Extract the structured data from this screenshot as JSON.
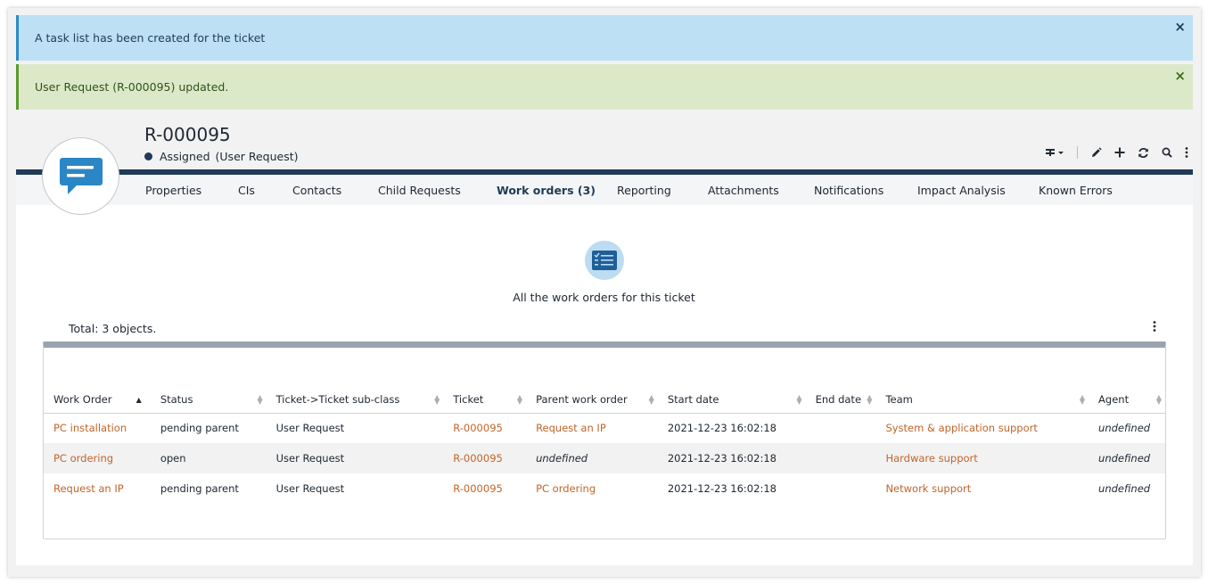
{
  "alerts": {
    "info": "A task list has been created for the ticket",
    "success": "User Request (R-000095) updated.",
    "close_symbol": "×"
  },
  "ticket": {
    "ref": "R-000095",
    "status": "Assigned",
    "class": "(User Request)"
  },
  "toolbar": {
    "icons": [
      "filter-dropdown-icon",
      "pencil-icon",
      "plus-icon",
      "refresh-icon",
      "search-icon",
      "more-vertical-icon"
    ]
  },
  "tabs": [
    {
      "label": "Properties"
    },
    {
      "label": "CIs"
    },
    {
      "label": "Contacts"
    },
    {
      "label": "Child Requests"
    },
    {
      "label": "Work orders (3)",
      "active": true
    },
    {
      "label": "Reporting"
    },
    {
      "label": "Attachments"
    },
    {
      "label": "Notifications"
    },
    {
      "label": "Impact Analysis"
    },
    {
      "label": "Known Errors"
    }
  ],
  "work_orders": {
    "description": "All the work orders for this ticket",
    "total": "Total: 3 objects.",
    "columns": [
      "Work Order",
      "Status",
      "Ticket->Ticket sub-class",
      "Ticket",
      "Parent work order",
      "Start date",
      "End date",
      "Team",
      "Agent"
    ],
    "rows": [
      {
        "work_order": "PC installation",
        "status": "pending parent",
        "subclass": "User Request",
        "ticket": "R-000095",
        "parent": "Request an IP",
        "start": "2021-12-23 16:02:18",
        "end": "",
        "team": "System & application support",
        "agent": "undefined"
      },
      {
        "work_order": "PC ordering",
        "status": "open",
        "subclass": "User Request",
        "ticket": "R-000095",
        "parent": "undefined",
        "start": "2021-12-23 16:02:18",
        "end": "",
        "team": "Hardware support",
        "agent": "undefined"
      },
      {
        "work_order": "Request an IP",
        "status": "pending parent",
        "subclass": "User Request",
        "ticket": "R-000095",
        "parent": "PC ordering",
        "start": "2021-12-23 16:02:18",
        "end": "",
        "team": "Network support",
        "agent": "undefined"
      }
    ]
  },
  "colors": {
    "header_bar": "#1f3b57",
    "link": "#c1652a",
    "info_bg": "#bde0f5",
    "success_bg": "#dce9c9"
  }
}
